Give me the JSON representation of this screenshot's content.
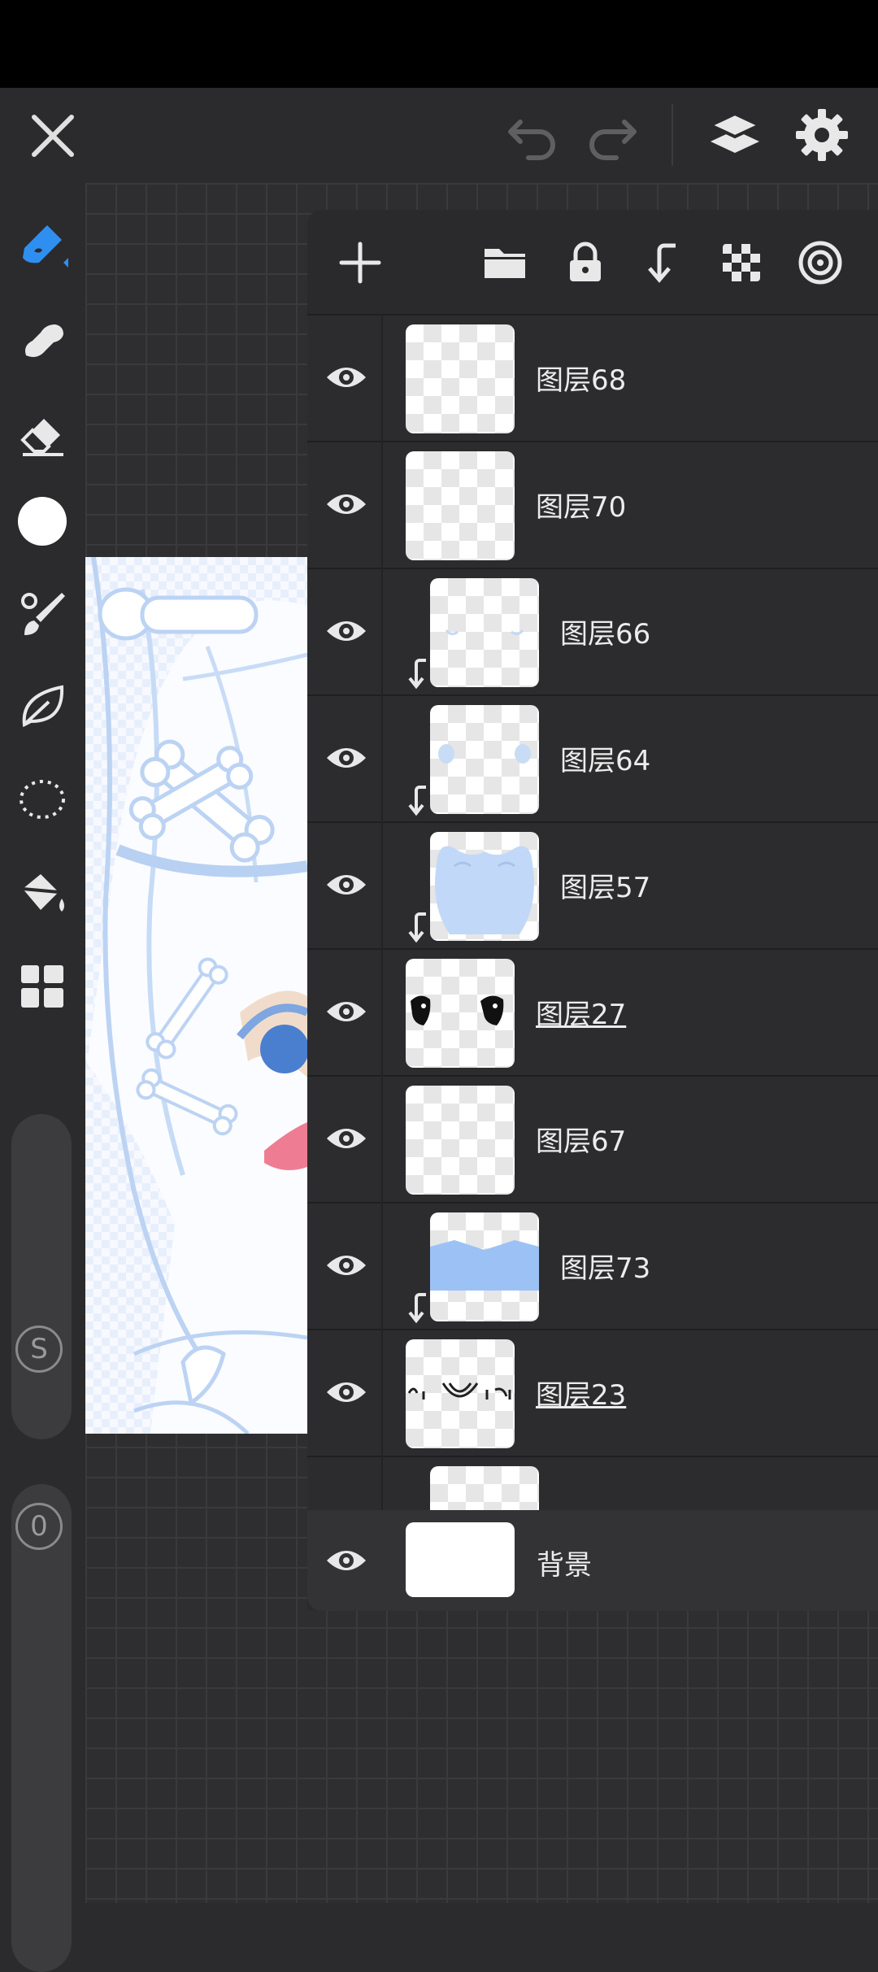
{
  "topbar": {
    "close": "close-icon",
    "undo": "undo-icon",
    "redo": "redo-icon",
    "layers": "layers-icon",
    "settings": "gear-icon"
  },
  "toolbar": {
    "tools": [
      "brush-icon",
      "smudge-icon",
      "eraser-icon",
      "color-swatch",
      "brush-settings-icon",
      "leaf-shape-icon",
      "lasso-select-icon",
      "fill-bucket-icon",
      "gallery-grid-icon"
    ],
    "size_label": "S",
    "opacity_label": "0",
    "active_color": "#2e8ff0"
  },
  "layers_panel": {
    "toolbar": [
      "add-layer-icon",
      "folder-icon",
      "lock-icon",
      "merge-down-icon",
      "transparency-icon",
      "blend-mode-icon"
    ],
    "layers": [
      {
        "name": "图层68",
        "clipped": false,
        "underline": false,
        "thumb": "empty"
      },
      {
        "name": "图层70",
        "clipped": false,
        "underline": false,
        "thumb": "empty"
      },
      {
        "name": "图层66",
        "clipped": true,
        "underline": false,
        "thumb": "eyelashes"
      },
      {
        "name": "图层64",
        "clipped": true,
        "underline": false,
        "thumb": "blush"
      },
      {
        "name": "图层57",
        "clipped": true,
        "underline": false,
        "thumb": "hood"
      },
      {
        "name": "图层27",
        "clipped": false,
        "underline": true,
        "thumb": "eyes"
      },
      {
        "name": "图层67",
        "clipped": false,
        "underline": false,
        "thumb": "empty"
      },
      {
        "name": "图层73",
        "clipped": true,
        "underline": false,
        "thumb": "collar"
      },
      {
        "name": "图层23",
        "clipped": false,
        "underline": true,
        "thumb": "lineart"
      }
    ],
    "background_layer": {
      "name": "背景",
      "thumb": "white"
    }
  }
}
